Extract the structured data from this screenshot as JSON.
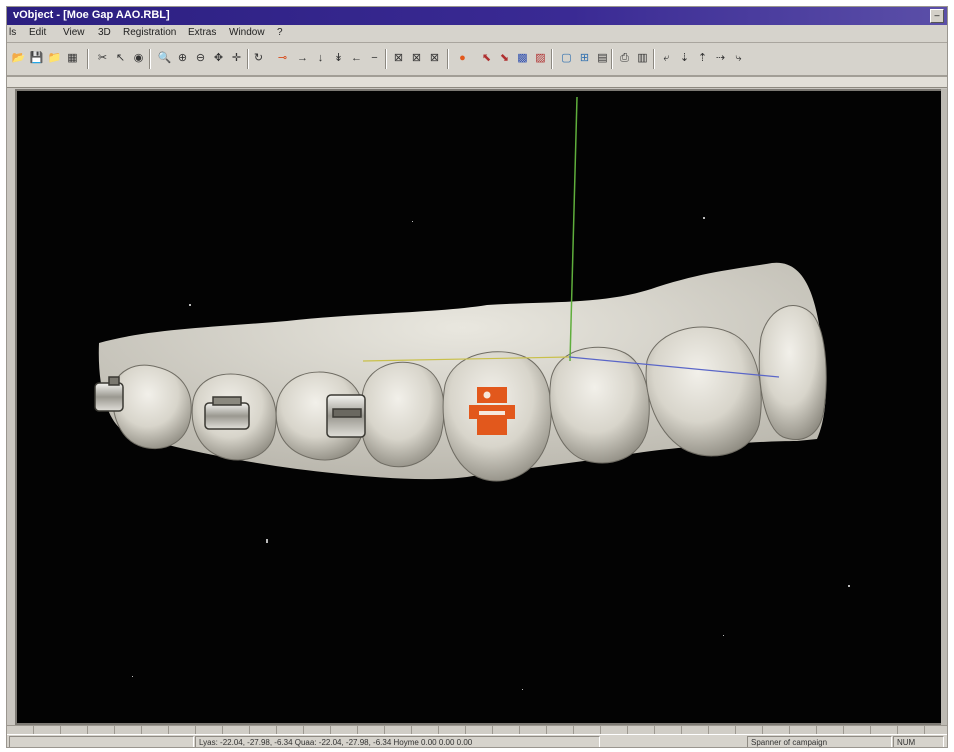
{
  "window": {
    "title": "vObject - [Moe Gap AAO.RBL]",
    "restore_glyph": "–"
  },
  "menu": {
    "items": [
      "ls",
      "Edit",
      "View",
      "3D",
      "Registration",
      "Extras",
      "Window",
      "?"
    ]
  },
  "toolbar": {
    "icons": [
      {
        "name": "open-folder-icon",
        "glyph": "📂"
      },
      {
        "name": "save-icon",
        "glyph": "💾"
      },
      {
        "name": "open-file-icon",
        "glyph": "📁"
      },
      {
        "name": "save-as-icon",
        "glyph": "▦"
      },
      {
        "name": "cut-icon",
        "glyph": "✂"
      },
      {
        "name": "pointer-icon",
        "glyph": "↖"
      },
      {
        "name": "palette-icon",
        "glyph": "◉"
      },
      {
        "name": "zoom-icon",
        "glyph": "🔍"
      },
      {
        "name": "zoom-in-icon",
        "glyph": "⊕"
      },
      {
        "name": "zoom-out-icon",
        "glyph": "⊖"
      },
      {
        "name": "move-icon",
        "glyph": "✥"
      },
      {
        "name": "pan-icon",
        "glyph": "✛"
      },
      {
        "name": "rotate-icon",
        "glyph": "↻"
      },
      {
        "name": "select-red-icon",
        "glyph": "⊸"
      },
      {
        "name": "arrow-right-icon",
        "glyph": "→"
      },
      {
        "name": "arrow-down-icon",
        "glyph": "↓"
      },
      {
        "name": "arrow-small-down-icon",
        "glyph": "↡"
      },
      {
        "name": "arrow-left-icon",
        "glyph": "←"
      },
      {
        "name": "minus-icon",
        "glyph": "−"
      },
      {
        "name": "view-front-icon",
        "glyph": "⊠"
      },
      {
        "name": "view-side-icon",
        "glyph": "⊠"
      },
      {
        "name": "view-top-icon",
        "glyph": "⊠"
      },
      {
        "name": "orange-dot-icon",
        "glyph": "●"
      },
      {
        "name": "select-tool-icon",
        "glyph": "⬉"
      },
      {
        "name": "select-tool-2-icon",
        "glyph": "⬊"
      },
      {
        "name": "grid-icon",
        "glyph": "▩"
      },
      {
        "name": "mesh-icon",
        "glyph": "▨"
      },
      {
        "name": "window-icon",
        "glyph": "▢"
      },
      {
        "name": "layout-icon",
        "glyph": "⊞"
      },
      {
        "name": "panel-icon",
        "glyph": "▤"
      },
      {
        "name": "print-icon",
        "glyph": "⎙"
      },
      {
        "name": "monitor-icon",
        "glyph": "▥"
      },
      {
        "name": "axis-icon",
        "glyph": "⤶"
      },
      {
        "name": "axis-2-icon",
        "glyph": "⇣"
      },
      {
        "name": "axis-3-icon",
        "glyph": "⇡"
      },
      {
        "name": "axis-4-icon",
        "glyph": "⇢"
      },
      {
        "name": "axis-5-icon",
        "glyph": "⤷"
      }
    ]
  },
  "colors": {
    "viewport_bg": "#030303",
    "marker": "#e2581c",
    "axis_green": "#5fae3c",
    "axis_yellow": "#c9c04a",
    "axis_blue": "#5a66c8"
  },
  "statusbar": {
    "coords": "Lyas: -22.04, -27.98, -6.34 Quaa: -22.04, -27.98, -6.34 Hoyme 0.00 0.00 0.00",
    "message": "Spanner of campaign",
    "mode": "NUM"
  }
}
